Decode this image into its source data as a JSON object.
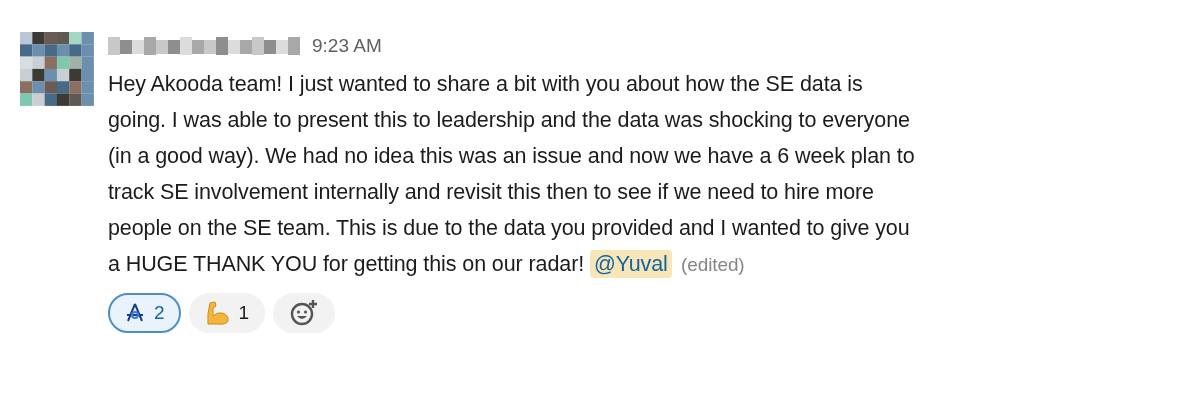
{
  "message": {
    "time": "9:23 AM",
    "lines": [
      "Hey Akooda team! I just wanted to share a bit with you about how the SE data is",
      "going. I was able to present this to leadership and the data was shocking to everyone",
      "(in a good way). We had no idea this was an issue and now we have a 6 week plan to",
      "track SE involvement internally and revisit this then to see if we need to hire more",
      "people on the SE team. This is due to the data you provided and I wanted to give you",
      "a HUGE THANK YOU for getting this on our radar! "
    ],
    "mention": "@Yuval",
    "edited": "(edited)",
    "reactions": [
      {
        "kind": "logo",
        "count": "2",
        "selected": true
      },
      {
        "kind": "muscle",
        "count": "1",
        "selected": false
      }
    ]
  }
}
